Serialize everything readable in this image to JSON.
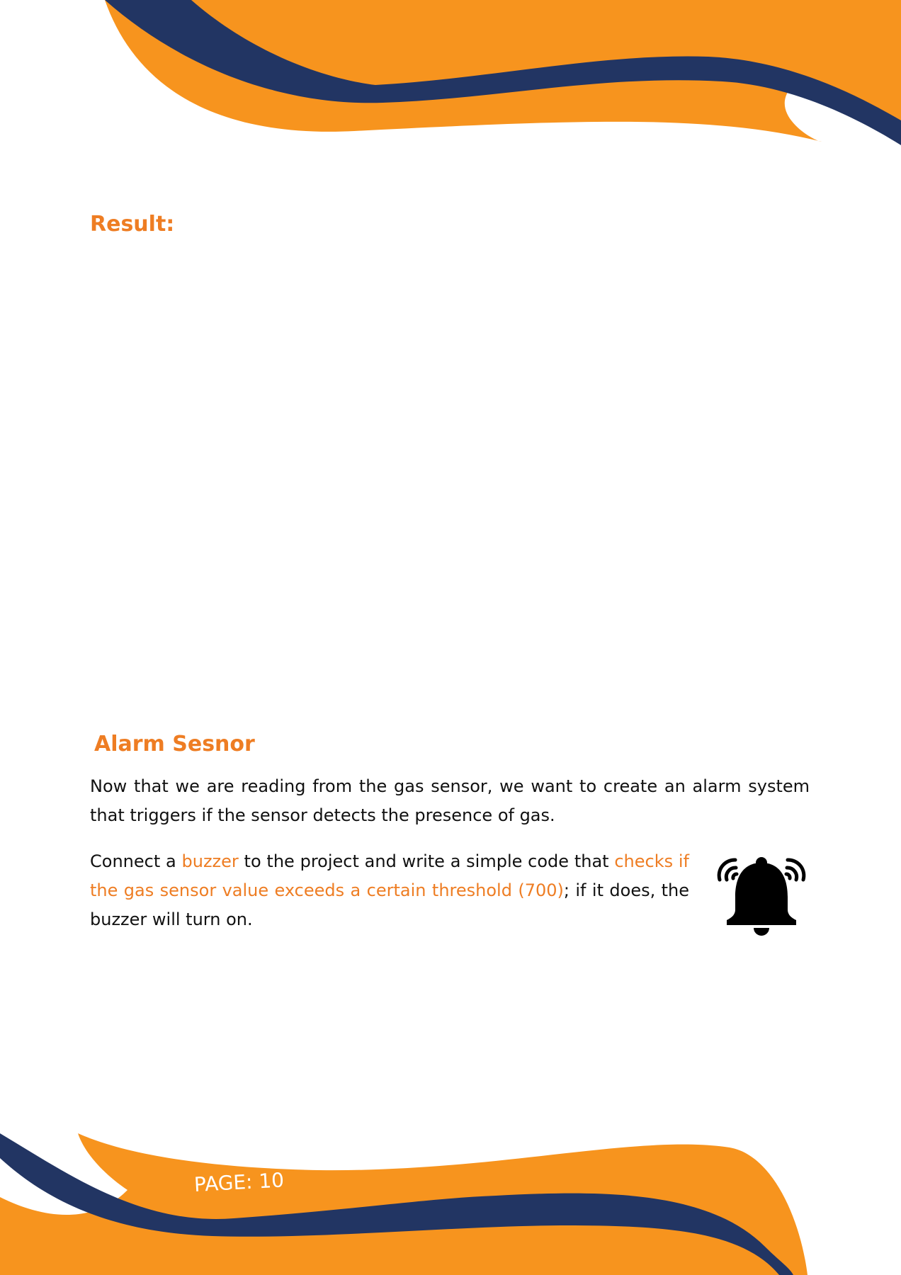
{
  "colors": {
    "accent": "#ee7d23",
    "orange": "#f7941e",
    "navy": "#223563",
    "text": "#111111"
  },
  "result_heading": "Result:",
  "alarm_heading": "Alarm Sesnor",
  "intro_paragraph": "Now that we are reading from the gas sensor, we want to create an alarm system that triggers if the sensor detects the presence of gas.",
  "task_paragraph": {
    "part1": "Connect a ",
    "highlight1": "buzzer",
    "part2": " to the project and write a simple code that ",
    "highlight2": "checks if the gas sensor value exceeds a certain threshold (700)",
    "part3": "; if it does, the buzzer will turn on."
  },
  "illustration_icon": "alarm-bell-icon",
  "footer": {
    "page_label": "PAGE: 10"
  }
}
